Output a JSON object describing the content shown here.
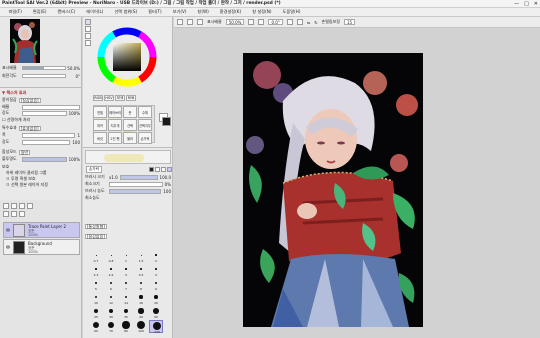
{
  "titlebar": {
    "title": "PaintTool SAI Ver.2 (64bit) Preview - NoriNaro - USB 드라이브 (D:) / 그림 / 그림 작업 / 작업 폴더 / 완작 / 그저 / render.psd (*)",
    "minimize": "—",
    "maximize": "□",
    "close": "✕"
  },
  "menu": {
    "items": [
      "파일(F)",
      "편집(E)",
      "캔버스(C)",
      "레이어(L)",
      "선택 범위(S)",
      "필터(T)",
      "보기(V)",
      "창(W)",
      "환경설정(K)",
      "창 설정(N)",
      "도움말(H)"
    ]
  },
  "navigator": {
    "zoom_label": "표시배율",
    "zoom_value": "50.0%",
    "angle_label": "회전각도",
    "angle_value": "0°",
    "zoom_fill": 0.5
  },
  "layer_props": {
    "section_effect": "▼ 텍스처 효과",
    "texture_label": "종이질감",
    "texture_value": "[질감없음]",
    "scale_label": "배율",
    "scale_value": "100%",
    "strength_label": "강도",
    "strength_value": "100",
    "color_label": "☐ 선명하게 처리",
    "section_effect2": "특수효과",
    "effect_value": "[효과없음]",
    "width_label": "폭",
    "width_value": "1",
    "intensity_label": "강도",
    "intensity_value": "100",
    "blend_label": "합성모드",
    "blend_value": "일반",
    "opacity_label": "불투명도",
    "opacity_value": "100%",
    "protect_label": "보호",
    "chk1": "하위 레이어 클리핑 그룹",
    "chk2": "ㅁ 투명 픽셀 보호",
    "chk3": "ㅁ 선택 원본 레이어 지정"
  },
  "layers": [
    {
      "name": "Trace Paint Layer 2",
      "mode": "표준",
      "opacity": "100%",
      "selected": true
    },
    {
      "name": "Background",
      "mode": "표준",
      "opacity": "100%",
      "selected": false
    }
  ],
  "color_panel": {
    "tabs": [
      "RGB",
      "HSV",
      "보색",
      "RYB"
    ],
    "fg_color": "#1a1a1a",
    "bg_color": "#ffffff",
    "accent": "#b9a84a"
  },
  "tool_panel": {
    "tool_labels": [
      "연필",
      "에어브러시",
      "붓",
      "수채",
      "마커",
      "지우개",
      "선택",
      "선택지우개",
      "버킷",
      "2진 펜",
      "블러",
      "손가락"
    ],
    "current_tool": "손가락",
    "brush_size_label": "브러시 크기",
    "brush_size_mult": "x1.0",
    "brush_size_value": "100.0",
    "min_size_label": "최소크기",
    "min_size_value": "0%",
    "density_label": "브러시 농도",
    "density_value": "100",
    "min_density_label": "최소농도",
    "shape_label": "[통상원형]",
    "texture_label": "[질감없음]",
    "sizes": [
      "0.7",
      "0.8",
      "1",
      "1.5",
      "2",
      "2.3",
      "2.6",
      "3",
      "3.5",
      "4",
      "5",
      "6",
      "7",
      "8",
      "9",
      "10",
      "12",
      "14",
      "16",
      "20",
      "25",
      "30",
      "35",
      "40",
      "50",
      "60",
      "70",
      "80",
      "100",
      "120"
    ],
    "active_size": "120"
  },
  "canvas_bar": {
    "zoom_label": "표시배율",
    "zoom_value": "50.0%",
    "angle_value": "0.0°",
    "stabilizer_label": "손떨림보정",
    "stabilizer_value": "15",
    "btn_flip": "⇋",
    "btn_rotate": "↻"
  }
}
